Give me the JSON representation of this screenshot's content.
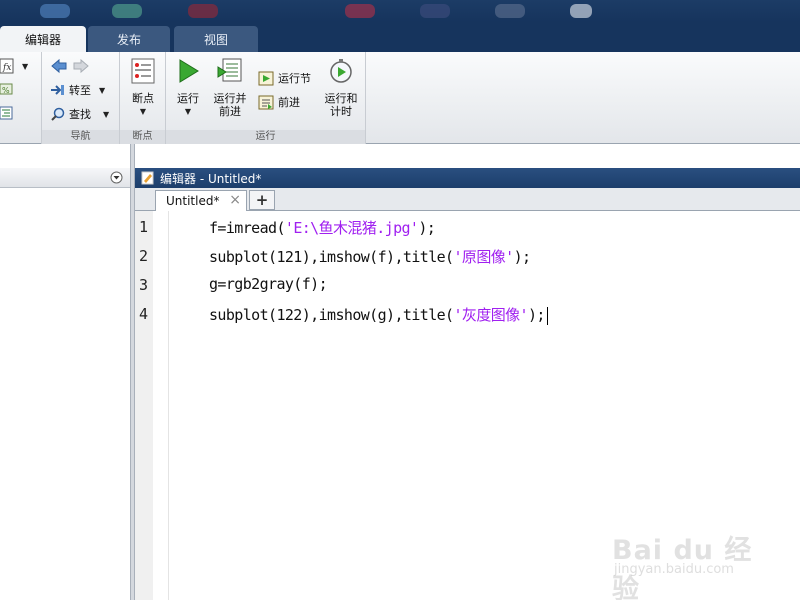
{
  "ribbon": {
    "tabs": [
      {
        "label": "编辑器",
        "active": true
      },
      {
        "label": "发布",
        "active": false
      },
      {
        "label": "视图",
        "active": false
      }
    ],
    "nav_group": {
      "goto_label": "转至",
      "find_label": "查找",
      "group_label": "导航"
    },
    "breakpoints_group": {
      "button_label": "断点",
      "group_label": "断点"
    },
    "run_group": {
      "run_label": "运行",
      "run_advance_label_1": "运行并",
      "run_advance_label_2": "前进",
      "run_section_label": "运行节",
      "advance_label": "前进",
      "run_time_label_1": "运行和",
      "run_time_label_2": "计时",
      "group_label": "运行"
    }
  },
  "editor": {
    "window_title": "编辑器 - Untitled*",
    "doc_tab_label": "Untitled*",
    "new_tab_glyph": "+",
    "close_glyph": "×",
    "line_numbers": [
      "1",
      "2",
      "3",
      "4"
    ],
    "lines": [
      {
        "pre": "f=imread(",
        "str": "'E:\\鱼木混猪.jpg'",
        "post": ");"
      },
      {
        "pre": "subplot(121),imshow(f),title(",
        "str": "'原图像'",
        "post": ");"
      },
      {
        "pre": "g=rgb2gray(f);",
        "str": "",
        "post": ""
      },
      {
        "pre": "subplot(122),imshow(g),title(",
        "str": "'灰度图像'",
        "post": ");"
      }
    ]
  },
  "colors": {
    "string": "#a020f0",
    "ribbon_dark": "#16345d",
    "editor_title": "#2a4f80"
  },
  "watermark": {
    "logo": "Bai du 经验",
    "url": "jingyan.baidu.com"
  }
}
